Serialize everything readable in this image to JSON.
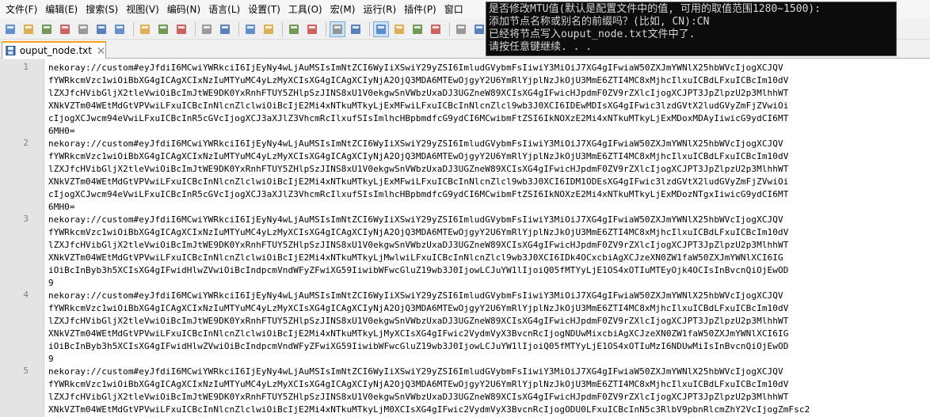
{
  "menubar": {
    "items": [
      "文件(F)",
      "编辑(E)",
      "搜索(S)",
      "视图(V)",
      "编码(N)",
      "语言(L)",
      "设置(T)",
      "工具(O)",
      "宏(M)",
      "运行(R)",
      "插件(P)",
      "窗口"
    ]
  },
  "toolbar": {
    "icons": [
      "new-file-icon",
      "open-file-icon",
      "save-icon",
      "save-all-icon",
      "close-icon",
      "close-all-icon",
      "print-icon",
      "cut-icon",
      "copy-icon",
      "paste-icon",
      "undo-icon",
      "redo-icon",
      "find-icon",
      "replace-icon",
      "zoom-in-icon",
      "zoom-out-icon",
      "sync-vertical-icon",
      "sync-horizontal-icon",
      "word-wrap-icon",
      "show-all-chars-icon",
      "indent-guide-icon",
      "doc-map-icon",
      "function-list-icon",
      "folder-workspace-icon",
      "monitor-icon"
    ]
  },
  "tab": {
    "label": "ouput_node.txt"
  },
  "editor": {
    "line_numbers": [
      "1",
      "2",
      "3",
      "4",
      "5"
    ],
    "lines": [
      "nekoray://custom#eyJfdiI6MCwiYWRkciI6IjEyNy4wLjAuMSIsImNtZCI6WyIiXSwiY29yZSI6ImludGVybmFsIiwiY3MiOiJ7XG4gIFwiaW50ZXJmYWNlX25hbWVcIjogXCJQV",
      "fYWRkcmVzc1wiOiBbXG4gICAgXCIxNzIuMTYuMC4yLzMyXCIsXG4gICAgXCIyNjA2OjQ3MDA6MTEwOjgyY2U6YmRlYjplNzJkOjU3MmE6ZTI4MC8xMjhcIlxuICBdLFxuICBcIm10dV",
      "lZXJfcHVibGljX2tleVwiOiBcImJtWE9DK0YxRnhFTUY5ZHlpSzJINS8xU1V0ekgwSnVWbzUxaDJ3UGZneW89XCIsXG4gIFwicHJpdmF0ZV9rZXlcIjogXCJPT3JpZlpzU2p3MlhhWT",
      "XNkVZTm04WEtMdGtVPVwiLFxuICBcInNlcnZlclwiOiBcIjE2Mi4xNTkuMTkyLjExMFwiLFxuICBcInNlcnZlcl9wb3J0XCI6IDEwMDIsXG4gIFwic3lzdGVtX2ludGVyZmFjZVwiOi",
      "cIjogXCJwcm94eVwiLFxuICBcInR5cGVcIjogXCJ3aXJlZ3VhcmRcIlxufSIsImlhcHBpbmdfcG9ydCI6MCwibmFtZSI6IkNOXzE2Mi4xNTkuMTkyLjExMDoxMDAyIiwicG9ydCI6MT",
      "6MH0=",
      "nekoray://custom#eyJfdiI6MCwiYWRkciI6IjEyNy4wLjAuMSIsImNtZCI6WyIiXSwiY29yZSI6ImludGVybmFsIiwiY3MiOiJ7XG4gIFwiaW50ZXJmYWNlX25hbWVcIjogXCJQV",
      "fYWRkcmVzc1wiOiBbXG4gICAgXCIxNzIuMTYuMC4yLzMyXCIsXG4gICAgXCIyNjA2OjQ3MDA6MTEwOjgyY2U6YmRlYjplNzJkOjU3MmE6ZTI4MC8xMjhcIlxuICBdLFxuICBcIm10dV",
      "lZXJfcHVibGljX2tleVwiOiBcImJtWE9DK0YxRnhFTUY5ZHlpSzJINS8xU1V0ekgwSnVWbzUxaDJ3UGZneW89XCIsXG4gIFwicHJpdmF0ZV9rZXlcIjogXCJPT3JpZlpzU2p3MlhhWT",
      "XNkVZTm04WEtMdGtVPVwiLFxuICBcInNlcnZlclwiOiBcIjE2Mi4xNTkuMTkyLjExMFwiLFxuICBcInNlcnZlcl9wb3J0XCI6IDM1ODEsXG4gIFwic3lzdGVtX2ludGVyZmFjZVwiOi",
      "cIjogXCJwcm94eVwiLFxuICBcInR5cGVcIjogXCJ3aXJlZ3VhcmRcIlxufSIsImlhcHBpbmdfcG9ydCI6MCwibmFtZSI6IkNOXzE2Mi4xNTkuMTkyLjExMDozNTgxIiwicG9ydCI6MT",
      "6MH0=",
      "nekoray://custom#eyJfdiI6MCwiYWRkciI6IjEyNy4wLjAuMSIsImNtZCI6WyIiXSwiY29yZSI6ImludGVybmFsIiwiY3MiOiJ7XG4gIFwiaW50ZXJmYWNlX25hbWVcIjogXCJQV",
      "fYWRkcmVzc1wiOiBbXG4gICAgXCIxNzIuMTYuMC4yLzMyXCIsXG4gICAgXCIyNjA2OjQ3MDA6MTEwOjgyY2U6YmRlYjplNzJkOjU3MmE6ZTI4MC8xMjhcIlxuICBdLFxuICBcIm10dV",
      "lZXJfcHVibGljX2tleVwiOiBcImJtWE9DK0YxRnhFTUY5ZHlpSzJINS8xU1V0ekgwSnVWbzUxaDJ3UGZneW89XCIsXG4gIFwicHJpdmF0ZV9rZXlcIjogXCJPT3JpZlpzU2p3MlhhWT",
      "XNkVZTm04WEtMdGtVPVwiLFxuICBcInNlcnZlclwiOiBcIjE2Mi4xNTkuMTkyLjMwlwiLFxuICBcInNlcnZlcl9wb3J0XCI6IDk4OCxcbiAgXCJzeXN0ZW1faW50ZXJmYWNlXCI6IG",
      "iOiBcInByb3h5XCIsXG4gIFwidHlwZVwiOiBcIndpcmVndWFyZFwiXG59IiwibWFwcGluZ19wb3J0IjowLCJuYW1lIjoiQ05fMTYyLjE1OS4xOTIuMTEyOjk4OCIsInBvcnQiOjEwOD",
      "9",
      "nekoray://custom#eyJfdiI6MCwiYWRkciI6IjEyNy4wLjAuMSIsImNtZCI6WyIiXSwiY29yZSI6ImludGVybmFsIiwiY3MiOiJ7XG4gIFwiaW50ZXJmYWNlX25hbWVcIjogXCJQV",
      "fYWRkcmVzc1wiOiBbXG4gICAgXCIxNzIuMTYuMC4yLzMyXCIsXG4gICAgXCIyNjA2OjQ3MDA6MTEwOjgyY2U6YmRlYjplNzJkOjU3MmE6ZTI4MC8xMjhcIlxuICBdLFxuICBcIm10dV",
      "lZXJfcHVibGljX2tleVwiOiBcImJtWE9DK0YxRnhFTUY5ZHlpSzJINS8xU1V0ekgwSnVWbzUxaDJ3UGZneW89XCIsXG4gIFwicHJpdmF0ZV9rZXlcIjogXCJPT3JpZlpzU2p3MlhhWT",
      "XNkVZTm04WEtMdGtVPVwiLFxuICBcInNlcnZlclwiOiBcIjE2Mi4xNTkuMTkyLjMyXCIsXG4gIFwic2VydmVyX3BvcnRcIjogNDUwMixcbiAgXCJzeXN0ZW1faW50ZXJmYWNlXCI6IG",
      "iOiBcInByb3h5XCIsXG4gIFwidHlwZVwiOiBcIndpcmVndWFyZFwiXG59IiwibWFwcGluZ19wb3J0IjowLCJuYW1lIjoiQ05fMTYyLjE1OS4xOTIuMzI6NDUwMiIsInBvcnQiOjEwOD",
      "9",
      "nekoray://custom#eyJfdiI6MCwiYWRkciI6IjEyNy4wLjAuMSIsImNtZCI6WyIiXSwiY29yZSI6ImludGVybmFsIiwiY3MiOiJ7XG4gIFwiaW50ZXJmYWNlX25hbWVcIjogXCJQV",
      "fYWRkcmVzc1wiOiBbXG4gICAgXCIxNzIuMTYuMC4yLzMyXCIsXG4gICAgXCIyNjA2OjQ3MDA6MTEwOjgyY2U6YmRlYjplNzJkOjU3MmE6ZTI4MC8xMjhcIlxuICBdLFxuICBcIm10dV",
      "lZXJfcHVibGljX2tleVwiOiBcImJtWE9DK0YxRnhFTUY5ZHlpSzJINS8xU1V0ekgwSnVWbzUxaDJ3UGZneW89XCIsXG4gIFwicHJpdmF0ZV9rZXlcIjogXCJPT3JpZlpzU2p3MlhhWT",
      "XNkVZTm04WEtMdGtVPVwiLFxuICBcInNlcnZlclwiOiBcIjE2Mi4xNTkuMTkyLjM0XCIsXG4gIFwic2VydmVyX3BvcnRcIjogODU0LFxuICBcInN5c3RlbV9pbnRlcmZhY2VcIjogZmFsc2"
    ]
  },
  "console": {
    "lines": [
      "是否修改MTU值(默认是配置文件中的值, 可用的取值范围1280~1500):",
      "添加节点名称或别名的前缀吗？(比如, CN):CN",
      "已经将节点写入ouput_node.txt文件中了.",
      "请按任意键继续. . ."
    ]
  }
}
